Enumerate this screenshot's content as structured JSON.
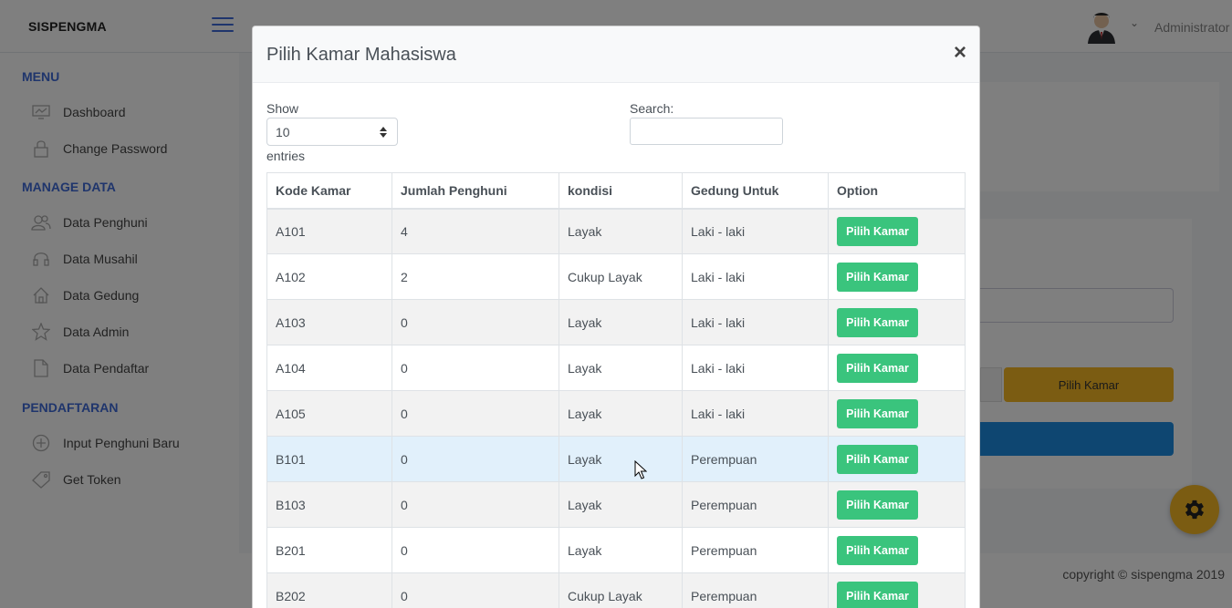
{
  "app": {
    "brand": "SISPENGMA",
    "user_name": "Administrator"
  },
  "sidebar": {
    "sections": [
      {
        "heading": "MENU",
        "items": [
          {
            "label": "Dashboard",
            "icon": "monitor-icon"
          },
          {
            "label": "Change Password",
            "icon": "lock-icon"
          }
        ]
      },
      {
        "heading": "MANAGE DATA",
        "items": [
          {
            "label": "Data Penghuni",
            "icon": "users-icon"
          },
          {
            "label": "Data Musahil",
            "icon": "headset-icon"
          },
          {
            "label": "Data Gedung",
            "icon": "home-icon"
          },
          {
            "label": "Data Admin",
            "icon": "star-icon"
          },
          {
            "label": "Data Pendaftar",
            "icon": "document-icon"
          }
        ]
      },
      {
        "heading": "PENDAFTARAN",
        "items": [
          {
            "label": "Input Penghuni Baru",
            "icon": "plus-circle-icon"
          },
          {
            "label": "Get Token",
            "icon": "tag-icon"
          }
        ]
      }
    ]
  },
  "background": {
    "yellow_button_label": "Pilih Kamar",
    "copyright": "copyright © sispengma 2019"
  },
  "modal": {
    "title": "Pilih Kamar Mahasiswa",
    "close_label": "×",
    "length": {
      "show_label": "Show",
      "selected": "10",
      "entries_label": "entries"
    },
    "search": {
      "label": "Search:",
      "value": ""
    },
    "table": {
      "columns": [
        "Kode Kamar",
        "Jumlah Penghuni",
        "kondisi",
        "Gedung Untuk",
        "Option"
      ],
      "button_label": "Pilih Kamar",
      "rows": [
        [
          "A101",
          "4",
          "Layak",
          "Laki - laki"
        ],
        [
          "A102",
          "2",
          "Cukup Layak",
          "Laki - laki"
        ],
        [
          "A103",
          "0",
          "Layak",
          "Laki - laki"
        ],
        [
          "A104",
          "0",
          "Layak",
          "Laki - laki"
        ],
        [
          "A105",
          "0",
          "Layak",
          "Laki - laki"
        ],
        [
          "B101",
          "0",
          "Layak",
          "Perempuan"
        ],
        [
          "B103",
          "0",
          "Layak",
          "Perempuan"
        ],
        [
          "B201",
          "0",
          "Layak",
          "Perempuan"
        ],
        [
          "B202",
          "0",
          "Cukup Layak",
          "Perempuan"
        ]
      ],
      "hovered_row": 5
    }
  },
  "colors": {
    "accent": "#3f6ad8",
    "success": "#3ac47d",
    "warning": "#f7b924",
    "info": "#1c8ce3"
  }
}
